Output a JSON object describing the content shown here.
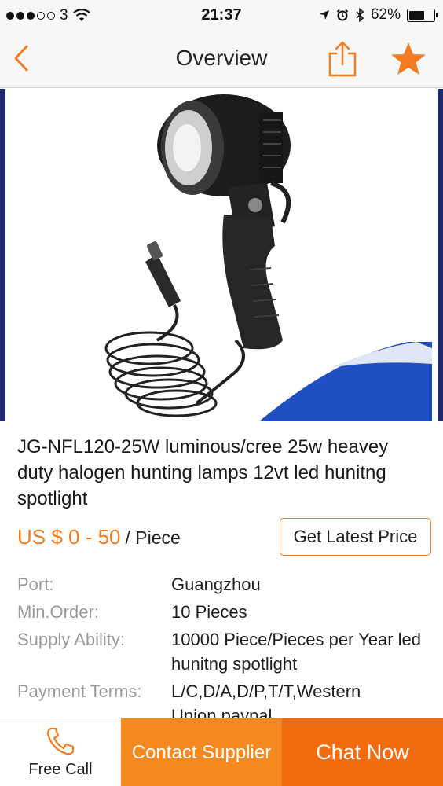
{
  "status_bar": {
    "carrier": "3",
    "time": "21:37",
    "battery": "62%",
    "battery_level": 0.62
  },
  "nav": {
    "title": "Overview"
  },
  "icons": {
    "back": "chevron-left-icon",
    "share": "share-icon",
    "favorite": "star-icon",
    "phone": "phone-icon"
  },
  "colors": {
    "accent": "#f47c20",
    "contact_bg": "#f5891f",
    "chat_bg": "#f26b0f"
  },
  "product": {
    "title": "JG-NFL120-25W luminous/cree 25w heavey duty halogen hunting lamps 12vt led hunitng spotlight",
    "price": "US $ 0 - 50",
    "unit": "/ Piece",
    "latest_price_button": "Get Latest Price"
  },
  "specs": [
    {
      "label": "Port:",
      "value": "Guangzhou"
    },
    {
      "label": "Min.Order:",
      "value": "10 Pieces"
    },
    {
      "label": "Supply Ability:",
      "value": "10000 Piece/Pieces per Year led hunitng spotlight"
    },
    {
      "label": "Payment Terms:",
      "value": "L/C,D/A,D/P,T/T,Western Union,paypal"
    }
  ],
  "bottom_bar": {
    "free_call": "Free Call",
    "contact_supplier": "Contact Supplier",
    "chat_now": "Chat Now"
  }
}
